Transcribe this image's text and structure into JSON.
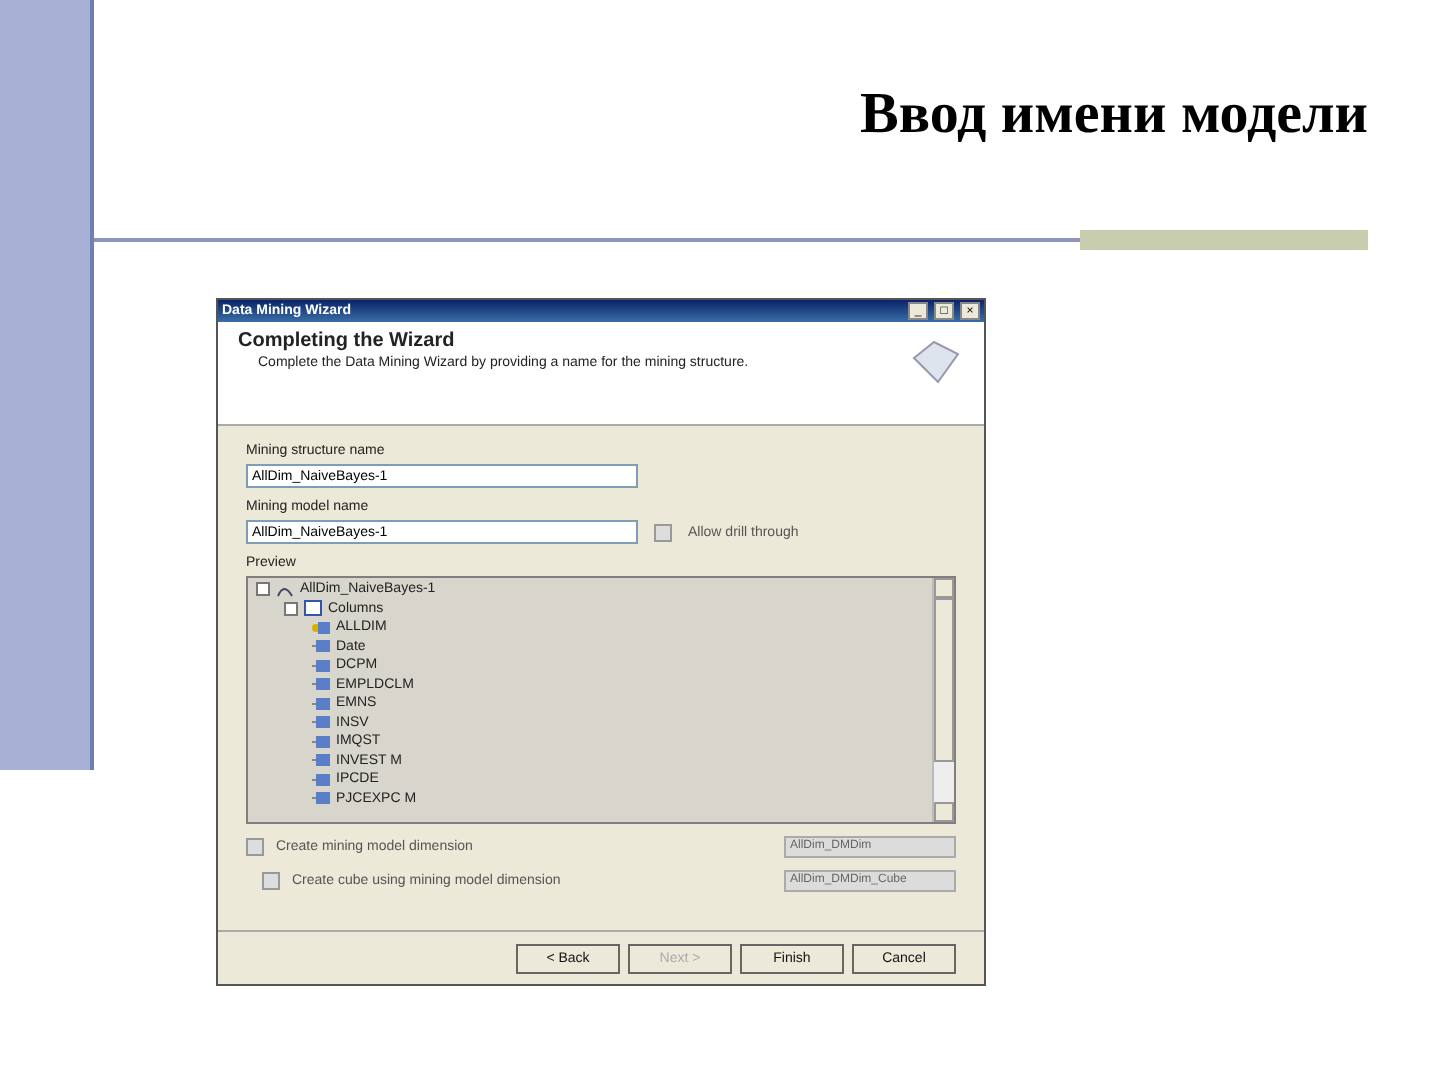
{
  "slide": {
    "title": "Ввод имени модели"
  },
  "window": {
    "title": "Data Mining Wizard",
    "controls": [
      "_",
      "□",
      "×"
    ]
  },
  "header": {
    "title": "Completing the Wizard",
    "subtitle": "Complete the Data Mining Wizard by providing a name for the mining structure."
  },
  "fields": [
    {
      "label": "Mining structure name",
      "value": "AllDim_NaiveBayes-1"
    },
    {
      "label": "Mining model name",
      "value": "AllDim_NaiveBayes-1"
    }
  ],
  "drillthrough": {
    "label": "Allow drill through",
    "checked": false
  },
  "preview": {
    "label": "Preview",
    "tree": [
      {
        "label": "AllDim_NaiveBayes-1",
        "kind": "structure",
        "expanded": true,
        "children": [
          {
            "label": "Columns",
            "kind": "folder",
            "expanded": true,
            "children": [
              {
                "label": "ALLDIM",
                "kind": "key"
              },
              {
                "label": "Date",
                "kind": "column"
              },
              {
                "label": "DCPM",
                "kind": "column"
              },
              {
                "label": "EMPLDCLM",
                "kind": "column"
              },
              {
                "label": "EMNS",
                "kind": "column"
              },
              {
                "label": "INSV",
                "kind": "column"
              },
              {
                "label": "IMQST",
                "kind": "column"
              },
              {
                "label": "INVEST M",
                "kind": "column"
              },
              {
                "label": "IPCDE",
                "kind": "column"
              },
              {
                "label": "PJCEXPC M",
                "kind": "column"
              }
            ]
          }
        ]
      }
    ]
  },
  "options": [
    {
      "label": "Create mining model dimension",
      "checked": false,
      "value": "AllDim_DMDim"
    },
    {
      "label": "Create cube using mining model dimension",
      "checked": false,
      "value": "AllDim_DMDim_Cube"
    }
  ],
  "buttons": [
    {
      "label": "< Back",
      "disabled": false
    },
    {
      "label": "Next >",
      "disabled": true
    },
    {
      "label": "Finish",
      "disabled": false
    },
    {
      "label": "Cancel",
      "disabled": false
    }
  ]
}
